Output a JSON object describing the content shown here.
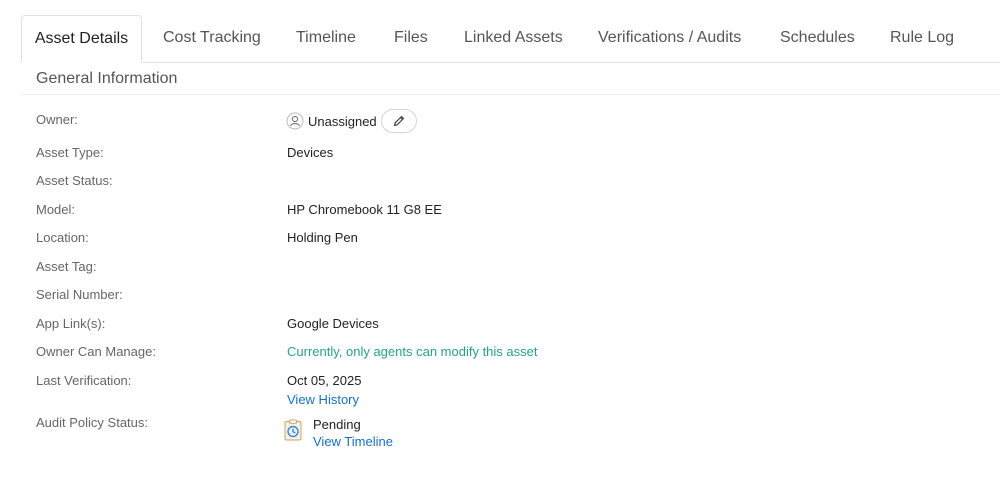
{
  "tabs": [
    {
      "label": "Asset Details"
    },
    {
      "label": "Cost Tracking"
    },
    {
      "label": "Timeline"
    },
    {
      "label": "Files"
    },
    {
      "label": "Linked Assets"
    },
    {
      "label": "Verifications / Audits"
    },
    {
      "label": "Schedules"
    },
    {
      "label": "Rule Log"
    }
  ],
  "active_tab": "Asset Details",
  "section": {
    "title": "General Information"
  },
  "fields": {
    "owner": {
      "label": "Owner:",
      "value": "Unassigned"
    },
    "asset_type": {
      "label": "Asset Type:",
      "value": "Devices"
    },
    "asset_status": {
      "label": "Asset Status:",
      "value": ""
    },
    "model": {
      "label": "Model:",
      "value": "HP Chromebook 11 G8 EE"
    },
    "location": {
      "label": "Location:",
      "value": "Holding Pen"
    },
    "asset_tag": {
      "label": "Asset Tag:",
      "value": ""
    },
    "serial_number": {
      "label": "Serial Number:",
      "value": ""
    },
    "app_links": {
      "label": "App Link(s):",
      "value": "Google Devices"
    },
    "owner_can_manage": {
      "label": "Owner Can Manage:",
      "value": "Currently, only agents can modify this asset"
    },
    "last_verification": {
      "label": "Last Verification:",
      "value": "Oct 05, 2025",
      "link": "View History"
    },
    "audit_policy_status": {
      "label": "Audit Policy Status:",
      "value": "Pending",
      "link": "View Timeline"
    }
  },
  "icons": {
    "owner": "user-icon",
    "edit": "pencil-icon",
    "audit": "clipboard-clock-icon"
  },
  "colors": {
    "link": "#1a6fbf",
    "teal": "#27a08a"
  }
}
